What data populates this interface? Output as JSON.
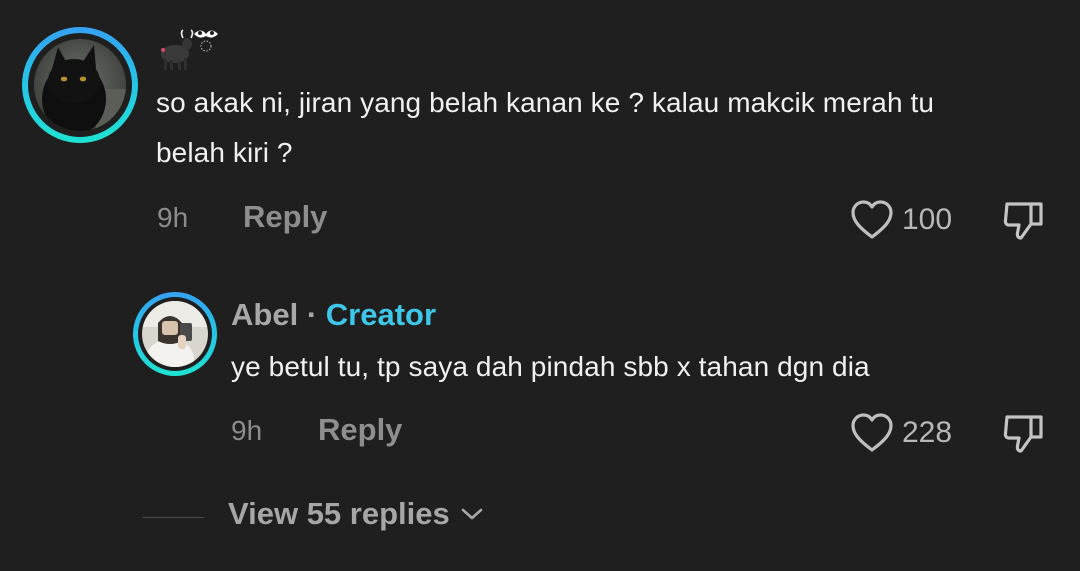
{
  "comment": {
    "username_icons": [
      "bull-emoji-icon",
      "mask-emoji-icon"
    ],
    "text_line1": "so akak ni, jiran yang belah kanan ke ? kalau makcik merah tu",
    "text_line2": "belah kiri ?",
    "time": "9h",
    "reply_label": "Reply",
    "likes": "100",
    "avatar": "black-cat-avatar"
  },
  "reply": {
    "author": "Abel",
    "separator": "·",
    "badge": "Creator",
    "text": "ye betul tu, tp saya dah pindah sbb x tahan dgn dia",
    "time": "9h",
    "reply_label": "Reply",
    "likes": "228",
    "avatar": "person-photo-avatar"
  },
  "view_more": {
    "label": "View 55 replies"
  },
  "colors": {
    "background": "#1f1f1f",
    "creator_accent": "#3ec7e8",
    "avatar_ring_top": "#35a2f4",
    "avatar_ring_bottom": "#1fe3d2"
  }
}
